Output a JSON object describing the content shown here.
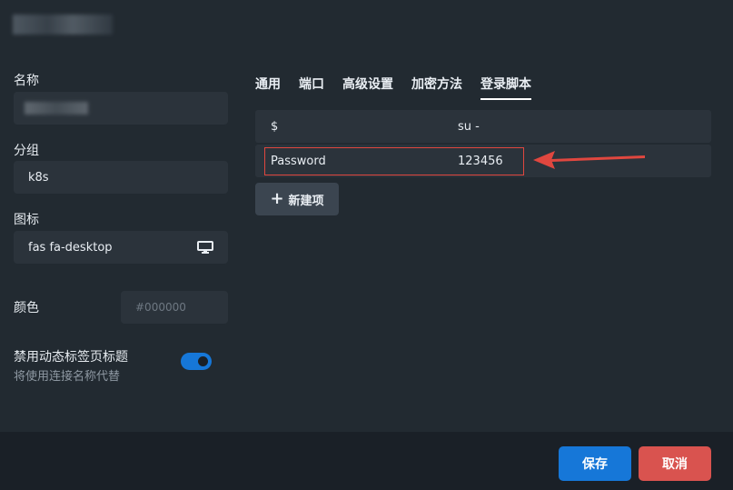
{
  "form": {
    "name_label": "名称",
    "group_label": "分组",
    "group_value": "k8s",
    "icon_label": "图标",
    "icon_value": "fas fa-desktop",
    "color_label": "颜色",
    "color_placeholder": "#000000",
    "toggle_label": "禁用动态标签页标题",
    "toggle_hint": "将使用连接名称代替",
    "toggle_on": true
  },
  "tabs": [
    {
      "label": "通用",
      "active": false
    },
    {
      "label": "端口",
      "active": false
    },
    {
      "label": "高级设置",
      "active": false
    },
    {
      "label": "加密方法",
      "active": false
    },
    {
      "label": "登录脚本",
      "active": true
    }
  ],
  "login_script": {
    "rows": [
      {
        "expect": "$",
        "send": "su -"
      },
      {
        "expect": "Password",
        "send": "123456"
      }
    ],
    "add_label": "新建项"
  },
  "footer": {
    "save_label": "保存",
    "cancel_label": "取消"
  },
  "colors": {
    "background": "#222a31",
    "field": "#2b333b",
    "accent": "#1677d8",
    "danger": "#d9534f",
    "highlight": "#e0473f"
  }
}
